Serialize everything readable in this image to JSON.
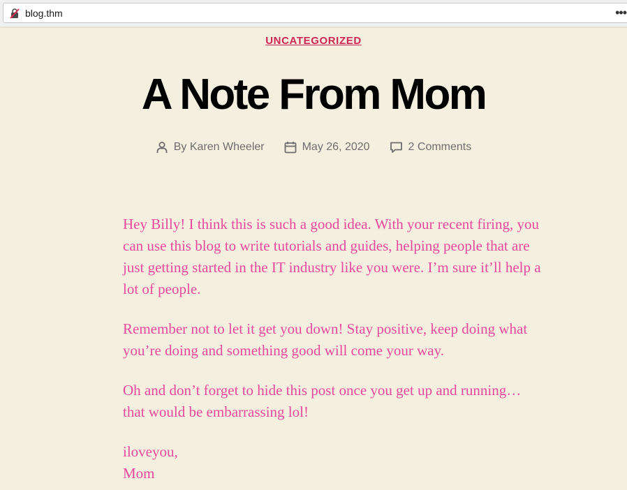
{
  "browser": {
    "url": "blog.thm",
    "more_glyph": "•••"
  },
  "post": {
    "category": "UNCATEGORIZED",
    "title": "A Note From Mom",
    "author_prefix": "By ",
    "author": "Karen Wheeler",
    "date": "May 26, 2020",
    "comments": "2 Comments"
  },
  "content": {
    "paragraphs": [
      "Hey Billy!  I think this is such a good idea.  With your recent firing, you can use this blog to write tutorials and guides, helping people that are just getting started in the IT industry like you were.  I’m sure it’ll help a lot of people.",
      "Remember not to let it get you down!  Stay positive, keep doing what you’re doing and something good will come your way.",
      "Oh and don’t forget to hide this post once you get up and running… that would be embarrassing lol!"
    ],
    "signoff_line1": "iloveyou,",
    "signoff_line2": "Mom"
  },
  "colors": {
    "accent": "#cd2653",
    "body_text": "#e8489c",
    "background": "#f5efe0"
  }
}
